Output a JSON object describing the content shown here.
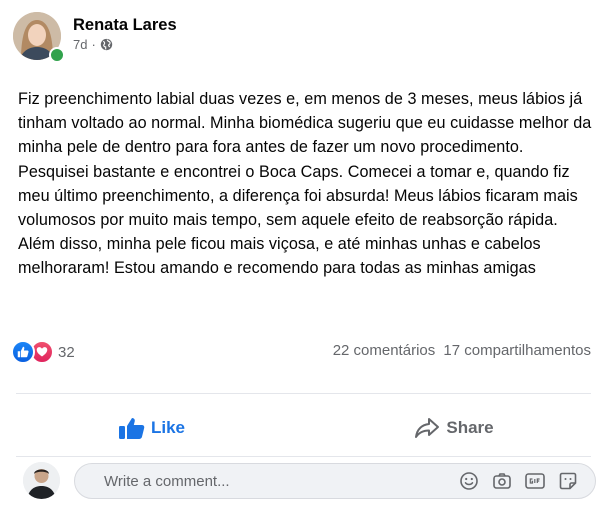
{
  "post": {
    "author": "Renata Lares",
    "time": "7d",
    "separator": "·",
    "text": "Fiz preenchimento labial duas vezes e, em menos de 3 meses, meus lábios já tinham voltado ao normal. Minha biomédica sugeriu que eu cuidasse melhor da minha pele de dentro para fora antes de fazer um novo procedimento. Pesquisei bastante e encontrei o Boca Caps. Comecei a tomar e, quando fiz meu último preenchimento, a diferença foi absurda! Meus lábios ficaram mais volumosos por muito mais tempo, sem aquele efeito de reabsorção rápida. Além disso, minha pele ficou mais viçosa, e até minhas unhas e cabelos melhoraram! Estou amando e recomendo para todas as minhas amigas",
    "reactions_count": "32",
    "comments": "22 comentários",
    "shares": "17 compartilhamentos"
  },
  "actions": {
    "like_label": "Like",
    "share_label": "Share"
  },
  "composer": {
    "placeholder": "Write a comment..."
  },
  "icons": [
    "globe-icon",
    "like-reaction-icon",
    "love-reaction-icon",
    "thumbs-up-icon",
    "share-arrow-icon",
    "emoji-icon",
    "camera-icon",
    "gif-icon",
    "sticker-icon"
  ],
  "colors": {
    "accent": "#1b74e4",
    "like_reaction": "#1877f2",
    "love_reaction": "#e0245e",
    "online": "#31a24c",
    "secondary_text": "#65676b"
  }
}
